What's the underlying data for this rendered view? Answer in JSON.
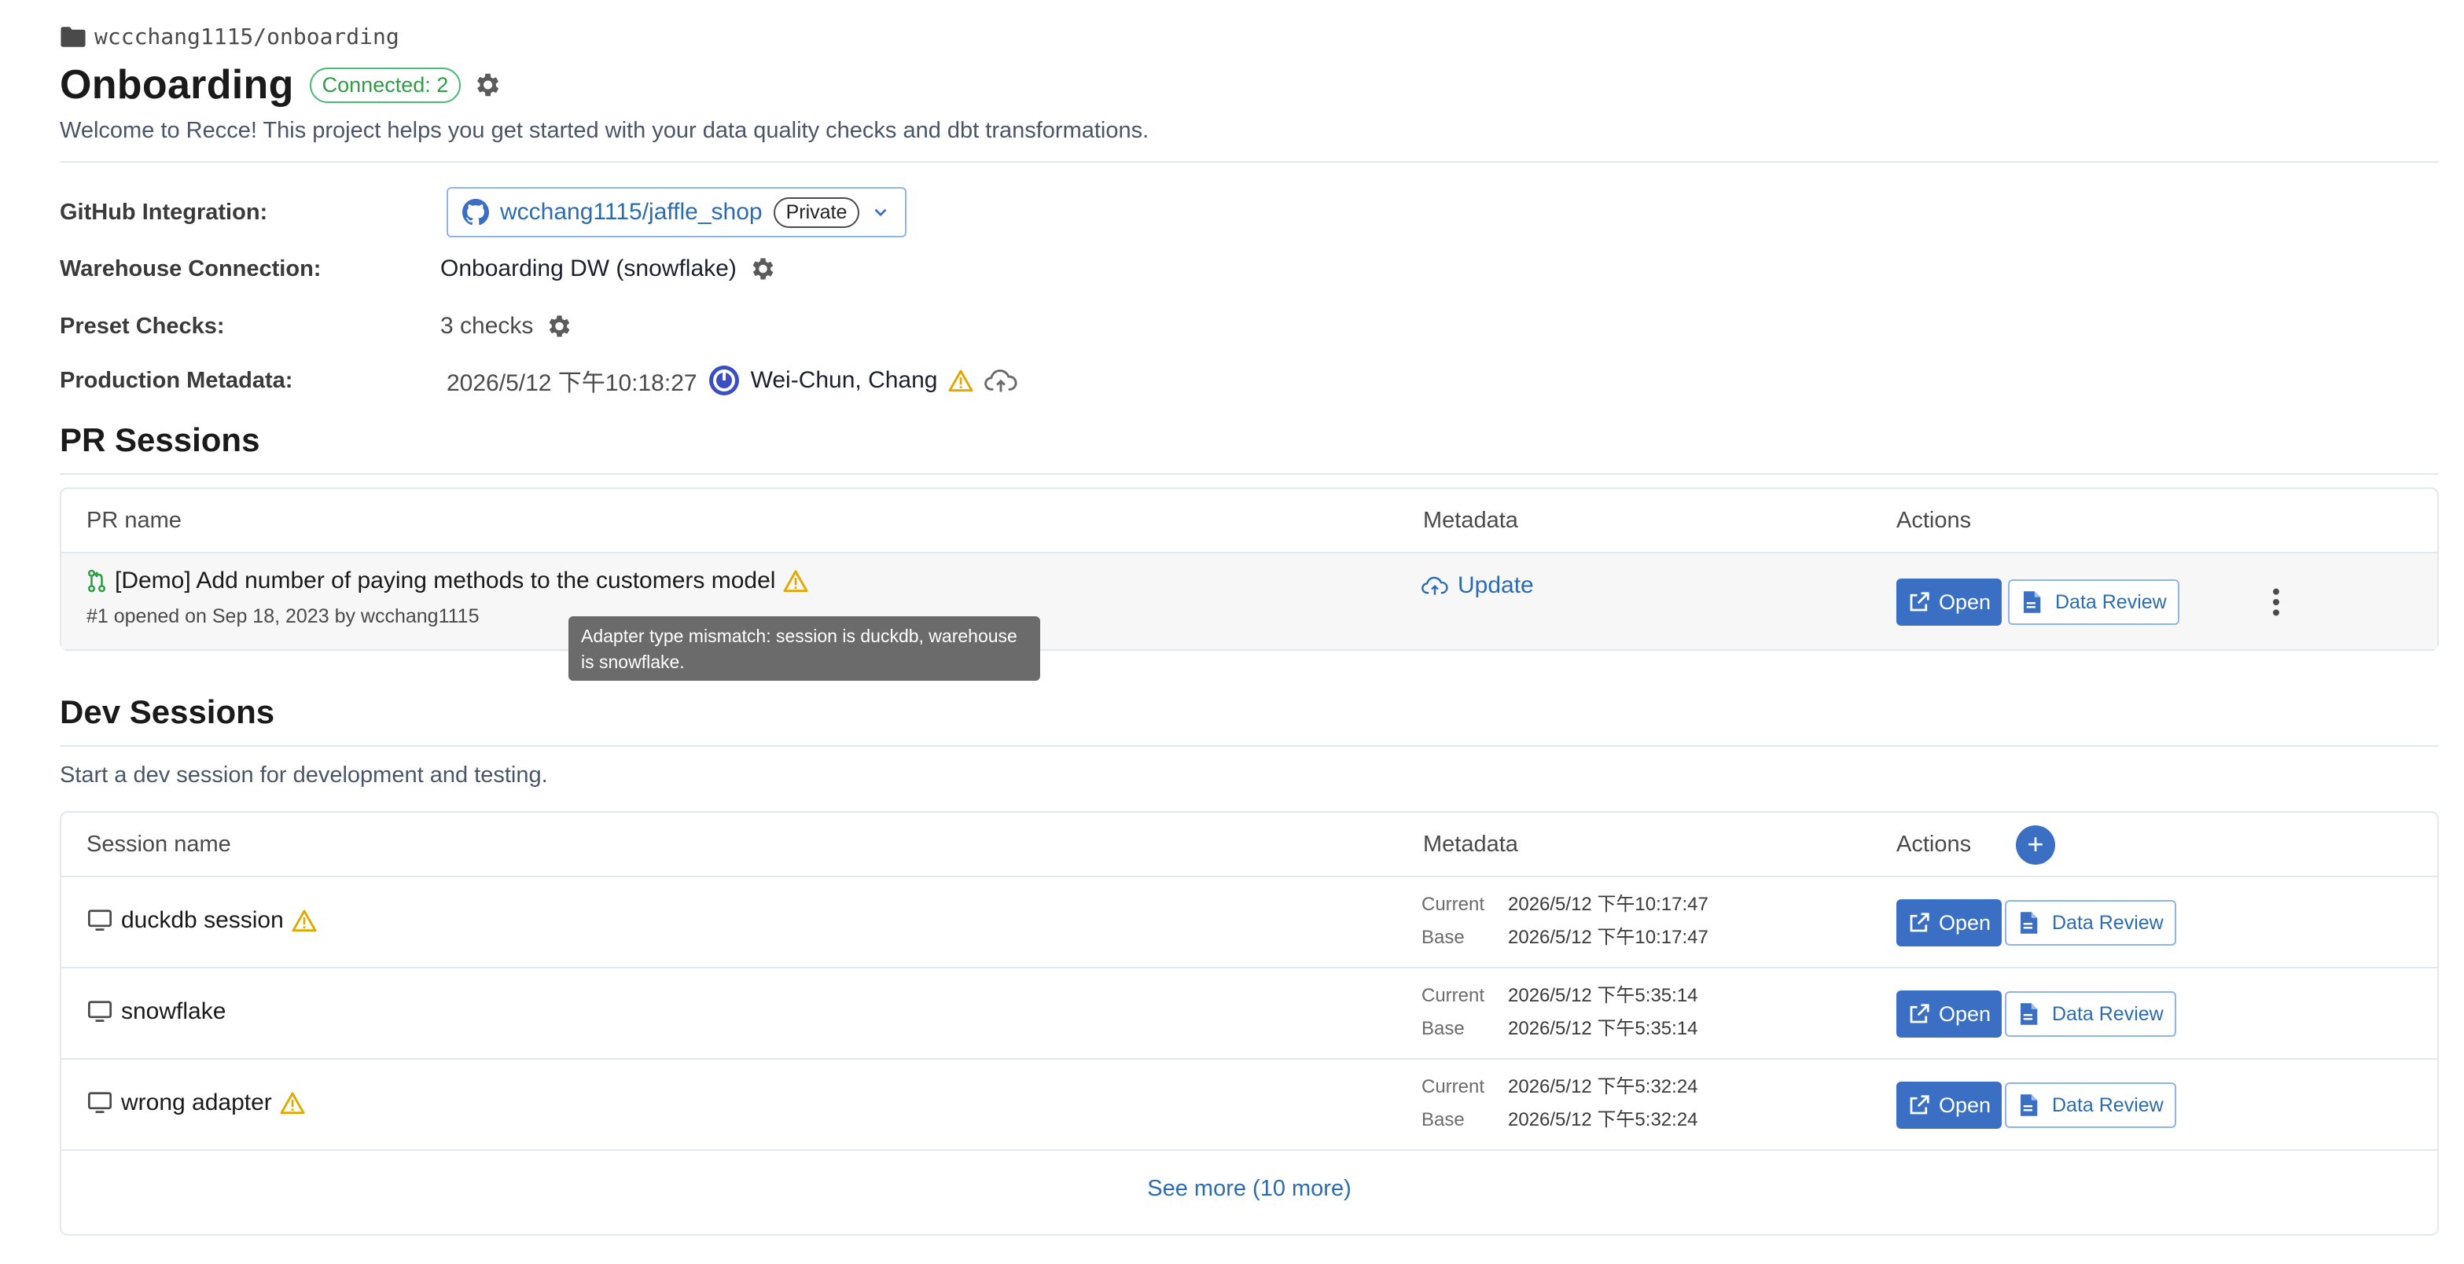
{
  "breadcrumb": {
    "path": "wccchang1115/onboarding",
    "icon": "folder-icon"
  },
  "header": {
    "title": "Onboarding",
    "connected_badge": "Connected: 2",
    "subtitle": "Welcome to Recce! This project helps you get started with your data quality checks and dbt transformations."
  },
  "info": {
    "github": {
      "label": "GitHub Integration:",
      "repo": "wcchang1115/jaffle_shop",
      "visibility": "Private"
    },
    "warehouse": {
      "label": "Warehouse Connection:",
      "value": "Onboarding DW (snowflake)"
    },
    "preset": {
      "label": "Preset Checks:",
      "value": "3 checks"
    },
    "production": {
      "label": "Production Metadata:",
      "timestamp": "2026/5/12 下午10:18:27",
      "user": "Wei-Chun, Chang"
    }
  },
  "pr_sessions": {
    "title": "PR Sessions",
    "columns": {
      "name": "PR name",
      "metadata": "Metadata",
      "actions": "Actions"
    },
    "rows": [
      {
        "name": "[Demo] Add number of paying methods to the customers model",
        "subtitle": "#1 opened on Sep 18, 2023 by wcchang1115",
        "metadata_action": "Update",
        "open_label": "Open",
        "review_label": "Data Review"
      }
    ],
    "tooltip": "Adapter type mismatch: session is duckdb, warehouse is snowflake."
  },
  "dev_sessions": {
    "title": "Dev Sessions",
    "description": "Start a dev session for development and testing.",
    "columns": {
      "name": "Session name",
      "metadata": "Metadata",
      "actions": "Actions"
    },
    "add_label": "+",
    "current_label": "Current",
    "base_label": "Base",
    "open_label": "Open",
    "review_label": "Data Review",
    "rows": [
      {
        "name": "duckdb session",
        "warning": true,
        "current": "2026/5/12 下午10:17:47",
        "base": "2026/5/12 下午10:17:47"
      },
      {
        "name": "snowflake",
        "warning": false,
        "current": "2026/5/12 下午5:35:14",
        "base": "2026/5/12 下午5:35:14"
      },
      {
        "name": "wrong adapter",
        "warning": true,
        "current": "2026/5/12 下午5:32:24",
        "base": "2026/5/12 下午5:32:24"
      }
    ],
    "see_more": "See more (10 more)"
  },
  "colors": {
    "accent": "#3b6fc4",
    "link": "#2b6cb0",
    "success": "#2f9e44",
    "warning": "#e0a800"
  }
}
